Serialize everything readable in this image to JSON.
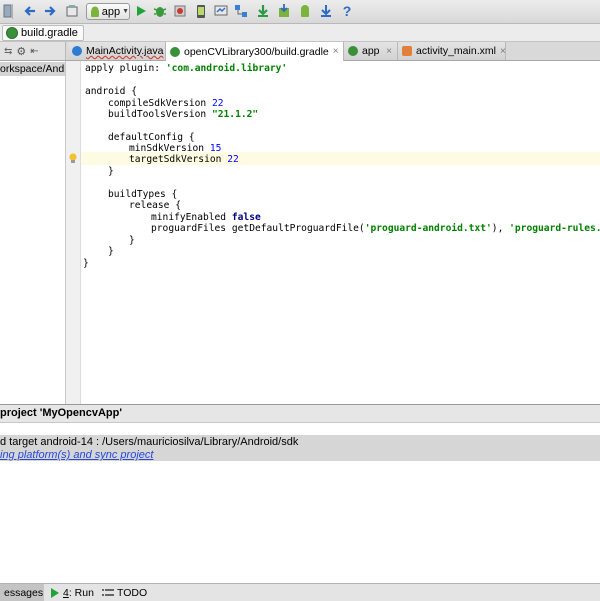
{
  "toolbar": {
    "run_config": "app",
    "icons": [
      "undo-icon",
      "redo-icon",
      "run-config-dropdown",
      "run-icon",
      "debug-icon",
      "attach-debugger-icon",
      "avd-manager-icon",
      "device-monitor-icon",
      "project-structure-icon",
      "sync-gradle-icon",
      "sdk-manager-icon",
      "android-device-icon",
      "help-icon"
    ]
  },
  "breadcrumb": {
    "label": "build.gradle"
  },
  "tabs": [
    {
      "label": "MainActivity.java",
      "icon": "class-icon"
    },
    {
      "label": "openCVLibrary300/build.gradle",
      "icon": "gradle-icon",
      "active": true
    },
    {
      "label": "app",
      "icon": "gradle-icon"
    },
    {
      "label": "activity_main.xml",
      "icon": "xml-icon"
    }
  ],
  "project_pane": {
    "path_fragment": "orkspace/Andr"
  },
  "editor": {
    "plugin_line": {
      "kw": "apply plugin: ",
      "value": "'com.android.library'"
    },
    "android_open": "android {",
    "compile_sdk": {
      "label": "compileSdkVersion ",
      "value": "22"
    },
    "build_tools": {
      "label": "buildToolsVersion ",
      "value": "\"21.1.2\""
    },
    "default_config_open": "defaultConfig {",
    "min_sdk": {
      "label": "minSdkVersion ",
      "value": "15"
    },
    "target_sdk": {
      "label": "targetSdkVersion ",
      "value": "22"
    },
    "close_brace": "}",
    "build_types_open": "buildTypes {",
    "release_open": "release {",
    "minify": {
      "label": "minifyEnabled ",
      "value": "false"
    },
    "proguard": {
      "label": "proguardFiles getDefaultProguardFile(",
      "arg1": "'proguard-android.txt'",
      "sep": "), ",
      "arg2": "'proguard-rules.txt'"
    }
  },
  "messages": {
    "header": "project 'MyOpencvApp'",
    "line1": "d target android-14 : /Users/mauriciosilva/Library/Android/sdk",
    "link": "ing platform(s) and sync project"
  },
  "bottom_tabs": {
    "messages": "essages",
    "run_number": "4",
    "run": ": Run",
    "todo": "TODO"
  },
  "colors": {
    "keyword": "#000080",
    "string": "#008000",
    "number": "#0000ff",
    "link": "#2747d8",
    "current_line": "#fdfbe2"
  }
}
